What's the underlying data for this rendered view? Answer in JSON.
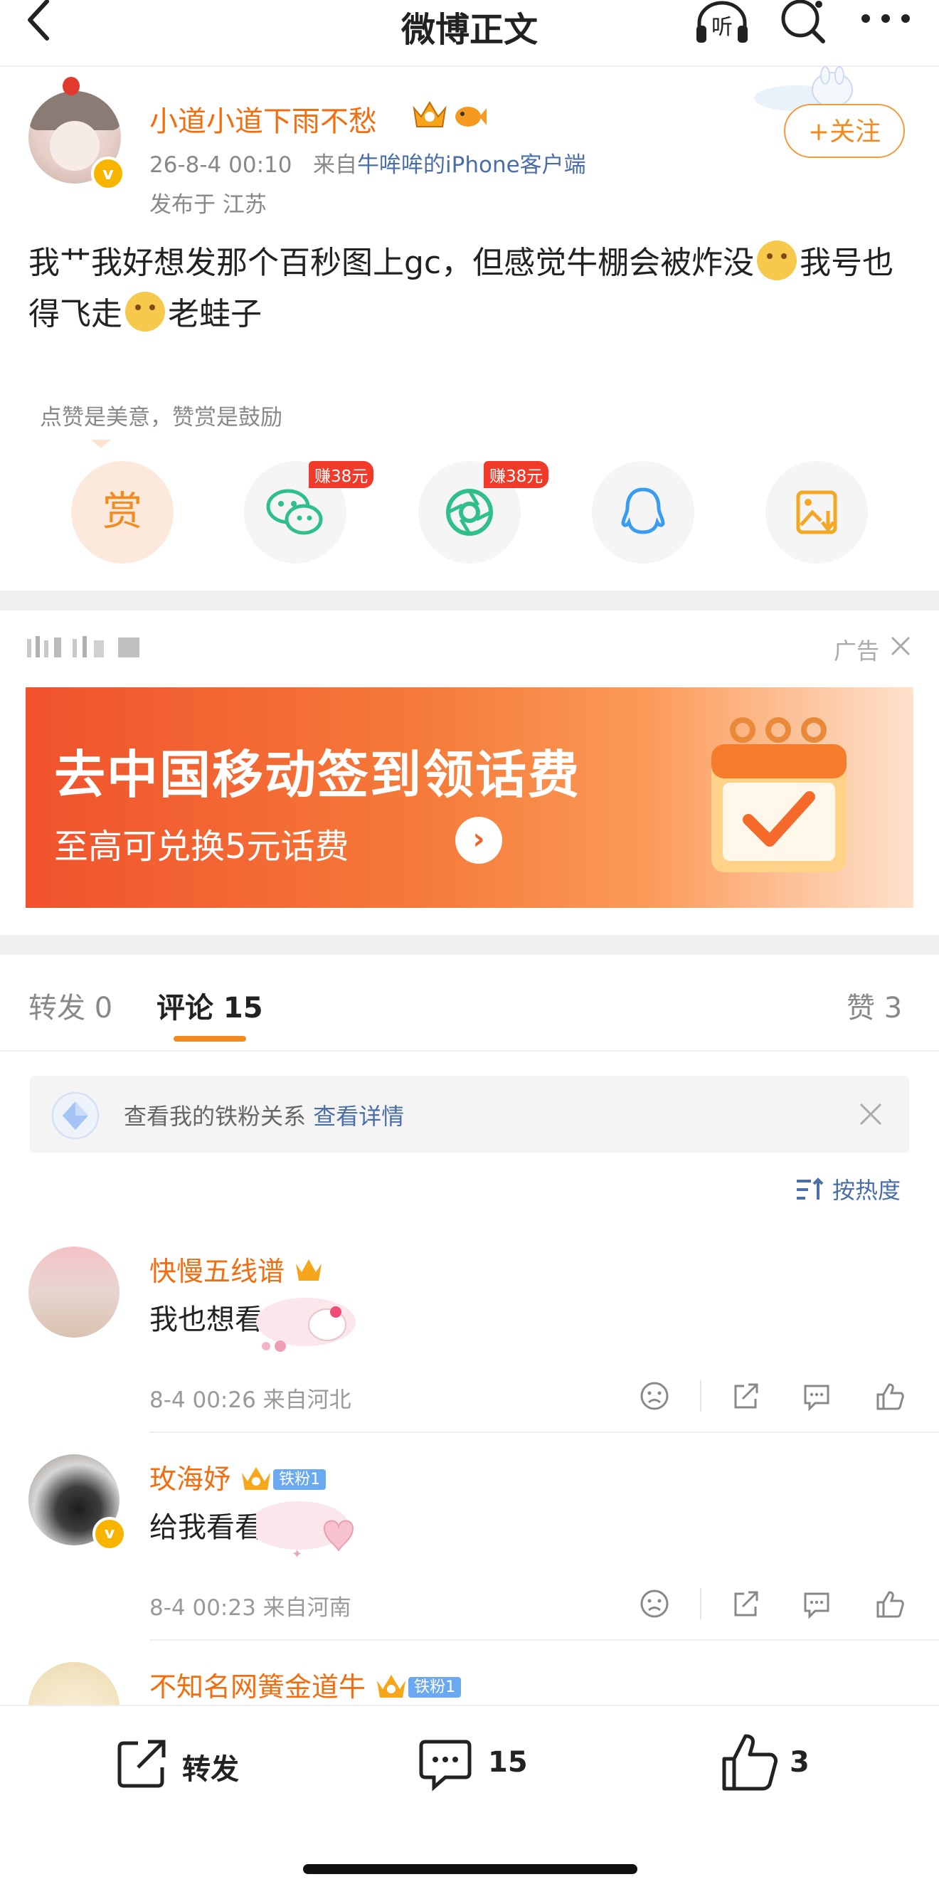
{
  "nav": {
    "title": "微博正文",
    "listen_label": "听"
  },
  "post": {
    "author": "小道小道下雨不愁",
    "verified_mark": "v",
    "time": "26-8-4 00:10",
    "source_prefix": "来自",
    "source": "牛哞哞的iPhone客户端",
    "location": "发布于 江苏",
    "follow_label": "+关注",
    "text_part1": "我艹我好想发那个百秒图上gc，但感觉牛棚会被炸没",
    "text_part2": "我号也得飞走",
    "text_part3": "老蛙子"
  },
  "reward": {
    "hint": "点赞是美意，赞赏是鼓励",
    "reward_label": "赏",
    "earn_tag_1": "赚38元",
    "earn_tag_2": "赚38元"
  },
  "ad": {
    "label": "广告",
    "headline": "去中国移动签到领话费",
    "sub": "至高可兑换5元话费",
    "arrow": "›"
  },
  "tabs": {
    "repost": "转发 0",
    "comments": "评论 15",
    "likes": "赞 3"
  },
  "fans_banner": {
    "text": "查看我的铁粉关系",
    "link": "查看详情"
  },
  "sort": {
    "label": "按热度"
  },
  "comments": [
    {
      "name": "快慢五线谱",
      "text": "我也想看",
      "meta": "8-4 00:26 来自河北",
      "fan_tag": ""
    },
    {
      "name": "玫海妤",
      "text": "给我看看",
      "meta": "8-4 00:23 来自河南",
      "fan_tag": "铁粉1"
    },
    {
      "name": "不知名网簧金道牛",
      "text": "",
      "meta": "",
      "fan_tag": "铁粉1"
    }
  ],
  "bottom_bar": {
    "repost": "转发",
    "comments": "15",
    "likes": "3"
  },
  "colors": {
    "accent": "#f28a1f",
    "name": "#f16e10",
    "link": "#4a6ea8",
    "ad_red": "#f0522c"
  },
  "icons": [
    "back-icon",
    "headphones-icon",
    "search-icon",
    "more-icon",
    "wechat-icon",
    "moments-icon",
    "qq-icon",
    "save-image-icon",
    "close-icon",
    "sort-icon",
    "dislike-icon",
    "share-icon",
    "comment-icon",
    "like-icon"
  ]
}
